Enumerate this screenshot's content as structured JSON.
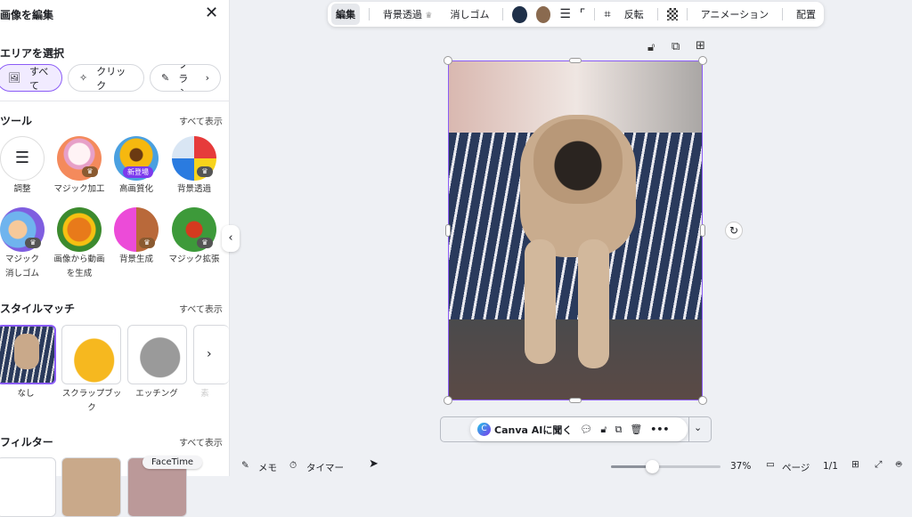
{
  "sidebar": {
    "title": "画像を編集",
    "close_icon": "close-icon",
    "area_title": "エリアを選択",
    "area_chips": [
      "すべて",
      "クリック",
      "ブラシ"
    ],
    "tools_title": "ツール",
    "see_all": "すべて表示",
    "tools": [
      {
        "label": "調整"
      },
      {
        "label": "マジック加工"
      },
      {
        "label": "高画質化",
        "badge": "新登場"
      },
      {
        "label": "背景透過"
      },
      {
        "label": "マジック\n消しゴム"
      },
      {
        "label": "画像から動画\nを生成"
      },
      {
        "label": "背景生成"
      },
      {
        "label": "マジック拡張"
      }
    ],
    "tool_label_lines": [
      "マジック",
      "消しゴム",
      "画像から動画",
      "を生成"
    ],
    "style_title": "スタイルマッチ",
    "styles": [
      "なし",
      "スクラップブッ",
      "ク",
      "エッチング",
      "素"
    ],
    "filter_title": "フィルター"
  },
  "toolbar": {
    "items": [
      "編集",
      "背景透過",
      "消しゴム",
      "反転",
      "アニメーション",
      "配置"
    ],
    "colors": [
      "#1f3049",
      "#8a6a4f"
    ]
  },
  "floating": {
    "ask_ai": "Canva AIに聞く"
  },
  "status": {
    "memo": "メモ",
    "timer": "タイマー",
    "zoom": "37%",
    "zoom_fraction": 0.37,
    "pages": "ページ",
    "page_count": "1/1"
  },
  "tooltip": "FaceTime"
}
